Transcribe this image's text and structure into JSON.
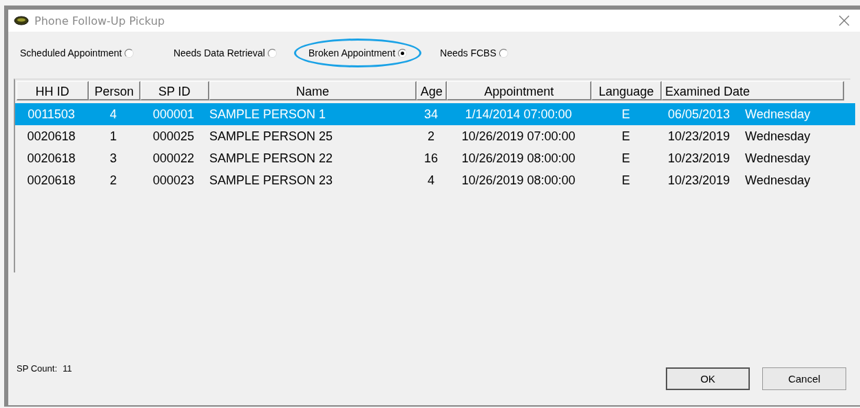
{
  "window": {
    "title": "Phone Follow-Up Pickup"
  },
  "filters": [
    {
      "label": "Scheduled Appointment",
      "selected": false,
      "highlighted": false
    },
    {
      "label": "Needs Data Retrieval",
      "selected": false,
      "highlighted": false
    },
    {
      "label": "Broken Appointment",
      "selected": true,
      "highlighted": true
    },
    {
      "label": "Needs FCBS",
      "selected": false,
      "highlighted": false
    }
  ],
  "table": {
    "columns": [
      "HH ID",
      "Person",
      "SP ID",
      "Name",
      "Age",
      "Appointment",
      "Language",
      "Examined Date"
    ],
    "rows": [
      {
        "selected": true,
        "cells": [
          "0011503",
          "4",
          "000001",
          "SAMPLE PERSON 1",
          "34",
          "1/14/2014 07:00:00",
          "E",
          "06/05/2013",
          "Wednesday"
        ]
      },
      {
        "selected": false,
        "cells": [
          "0020618",
          "1",
          "000025",
          "SAMPLE PERSON 25",
          "2",
          "10/26/2019 07:00:00",
          "E",
          "10/23/2019",
          "Wednesday"
        ]
      },
      {
        "selected": false,
        "cells": [
          "0020618",
          "3",
          "000022",
          "SAMPLE PERSON 22",
          "16",
          "10/26/2019 08:00:00",
          "E",
          "10/23/2019",
          "Wednesday"
        ]
      },
      {
        "selected": false,
        "cells": [
          "0020618",
          "2",
          "000023",
          "SAMPLE PERSON 23",
          "4",
          "10/26/2019 08:00:00",
          "E",
          "10/23/2019",
          "Wednesday"
        ]
      }
    ]
  },
  "count": {
    "label": "SP Count:",
    "value": "11"
  },
  "buttons": [
    "OK",
    "Cancel"
  ]
}
